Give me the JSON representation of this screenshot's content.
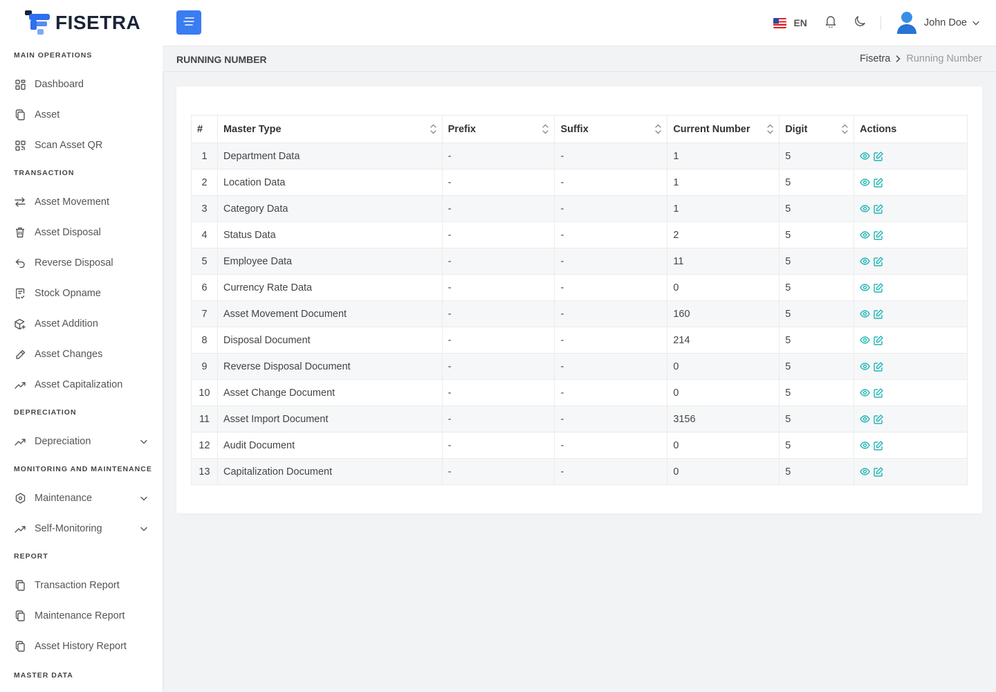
{
  "app": {
    "name": "FISETRA",
    "brand_color": "#3a7cf2"
  },
  "sidebar": {
    "sections": [
      {
        "title": "MAIN OPERATIONS",
        "items": [
          {
            "label": "Dashboard",
            "icon": "dashboard-grid-icon"
          },
          {
            "label": "Asset",
            "icon": "copy-icon"
          },
          {
            "label": "Scan Asset QR",
            "icon": "qr-icon"
          }
        ]
      },
      {
        "title": "TRANSACTION",
        "items": [
          {
            "label": "Asset Movement",
            "icon": "swap-arrows-icon"
          },
          {
            "label": "Asset Disposal",
            "icon": "trash-icon"
          },
          {
            "label": "Reverse Disposal",
            "icon": "undo-icon"
          },
          {
            "label": "Stock Opname",
            "icon": "clipboard-check-icon"
          },
          {
            "label": "Asset Addition",
            "icon": "box-plus-icon"
          },
          {
            "label": "Asset Changes",
            "icon": "pencil-icon"
          },
          {
            "label": "Asset Capitalization",
            "icon": "trending-up-icon"
          }
        ]
      },
      {
        "title": "DEPRECIATION",
        "items": [
          {
            "label": "Depreciation",
            "icon": "trending-up-icon",
            "expandable": true
          }
        ]
      },
      {
        "title": "MONITORING AND MAINTENANCE",
        "items": [
          {
            "label": "Maintenance",
            "icon": "hexagon-cog-icon",
            "expandable": true
          },
          {
            "label": "Self-Monitoring",
            "icon": "trending-up-icon",
            "expandable": true
          }
        ]
      },
      {
        "title": "REPORT",
        "items": [
          {
            "label": "Transaction Report",
            "icon": "copy-icon"
          },
          {
            "label": "Maintenance Report",
            "icon": "copy-icon"
          },
          {
            "label": "Asset History Report",
            "icon": "copy-icon"
          }
        ]
      },
      {
        "title": "MASTER DATA",
        "items": []
      }
    ]
  },
  "header": {
    "language": "EN",
    "user_name": "John Doe"
  },
  "page": {
    "title": "RUNNING NUMBER",
    "breadcrumb": {
      "home": "Fisetra",
      "current": "Running Number"
    }
  },
  "table": {
    "columns": [
      "#",
      "Master Type",
      "Prefix",
      "Suffix",
      "Current Number",
      "Digit",
      "Actions"
    ],
    "rows": [
      {
        "no": "1",
        "master_type": "Department Data",
        "prefix": "-",
        "suffix": "-",
        "current_number": "1",
        "digit": "5"
      },
      {
        "no": "2",
        "master_type": "Location Data",
        "prefix": "-",
        "suffix": "-",
        "current_number": "1",
        "digit": "5"
      },
      {
        "no": "3",
        "master_type": "Category Data",
        "prefix": "-",
        "suffix": "-",
        "current_number": "1",
        "digit": "5"
      },
      {
        "no": "4",
        "master_type": "Status Data",
        "prefix": "-",
        "suffix": "-",
        "current_number": "2",
        "digit": "5"
      },
      {
        "no": "5",
        "master_type": "Employee Data",
        "prefix": "-",
        "suffix": "-",
        "current_number": "11",
        "digit": "5"
      },
      {
        "no": "6",
        "master_type": "Currency Rate Data",
        "prefix": "-",
        "suffix": "-",
        "current_number": "0",
        "digit": "5"
      },
      {
        "no": "7",
        "master_type": "Asset Movement Document",
        "prefix": "-",
        "suffix": "-",
        "current_number": "160",
        "digit": "5"
      },
      {
        "no": "8",
        "master_type": "Disposal Document",
        "prefix": "-",
        "suffix": "-",
        "current_number": "214",
        "digit": "5"
      },
      {
        "no": "9",
        "master_type": "Reverse Disposal Document",
        "prefix": "-",
        "suffix": "-",
        "current_number": "0",
        "digit": "5"
      },
      {
        "no": "10",
        "master_type": "Asset Change Document",
        "prefix": "-",
        "suffix": "-",
        "current_number": "0",
        "digit": "5"
      },
      {
        "no": "11",
        "master_type": "Asset Import Document",
        "prefix": "-",
        "suffix": "-",
        "current_number": "3156",
        "digit": "5"
      },
      {
        "no": "12",
        "master_type": "Audit Document",
        "prefix": "-",
        "suffix": "-",
        "current_number": "0",
        "digit": "5"
      },
      {
        "no": "13",
        "master_type": "Capitalization Document",
        "prefix": "-",
        "suffix": "-",
        "current_number": "0",
        "digit": "5"
      }
    ],
    "action_icons": [
      "eye-icon",
      "edit-icon"
    ],
    "action_color": "#1fb5b5"
  }
}
